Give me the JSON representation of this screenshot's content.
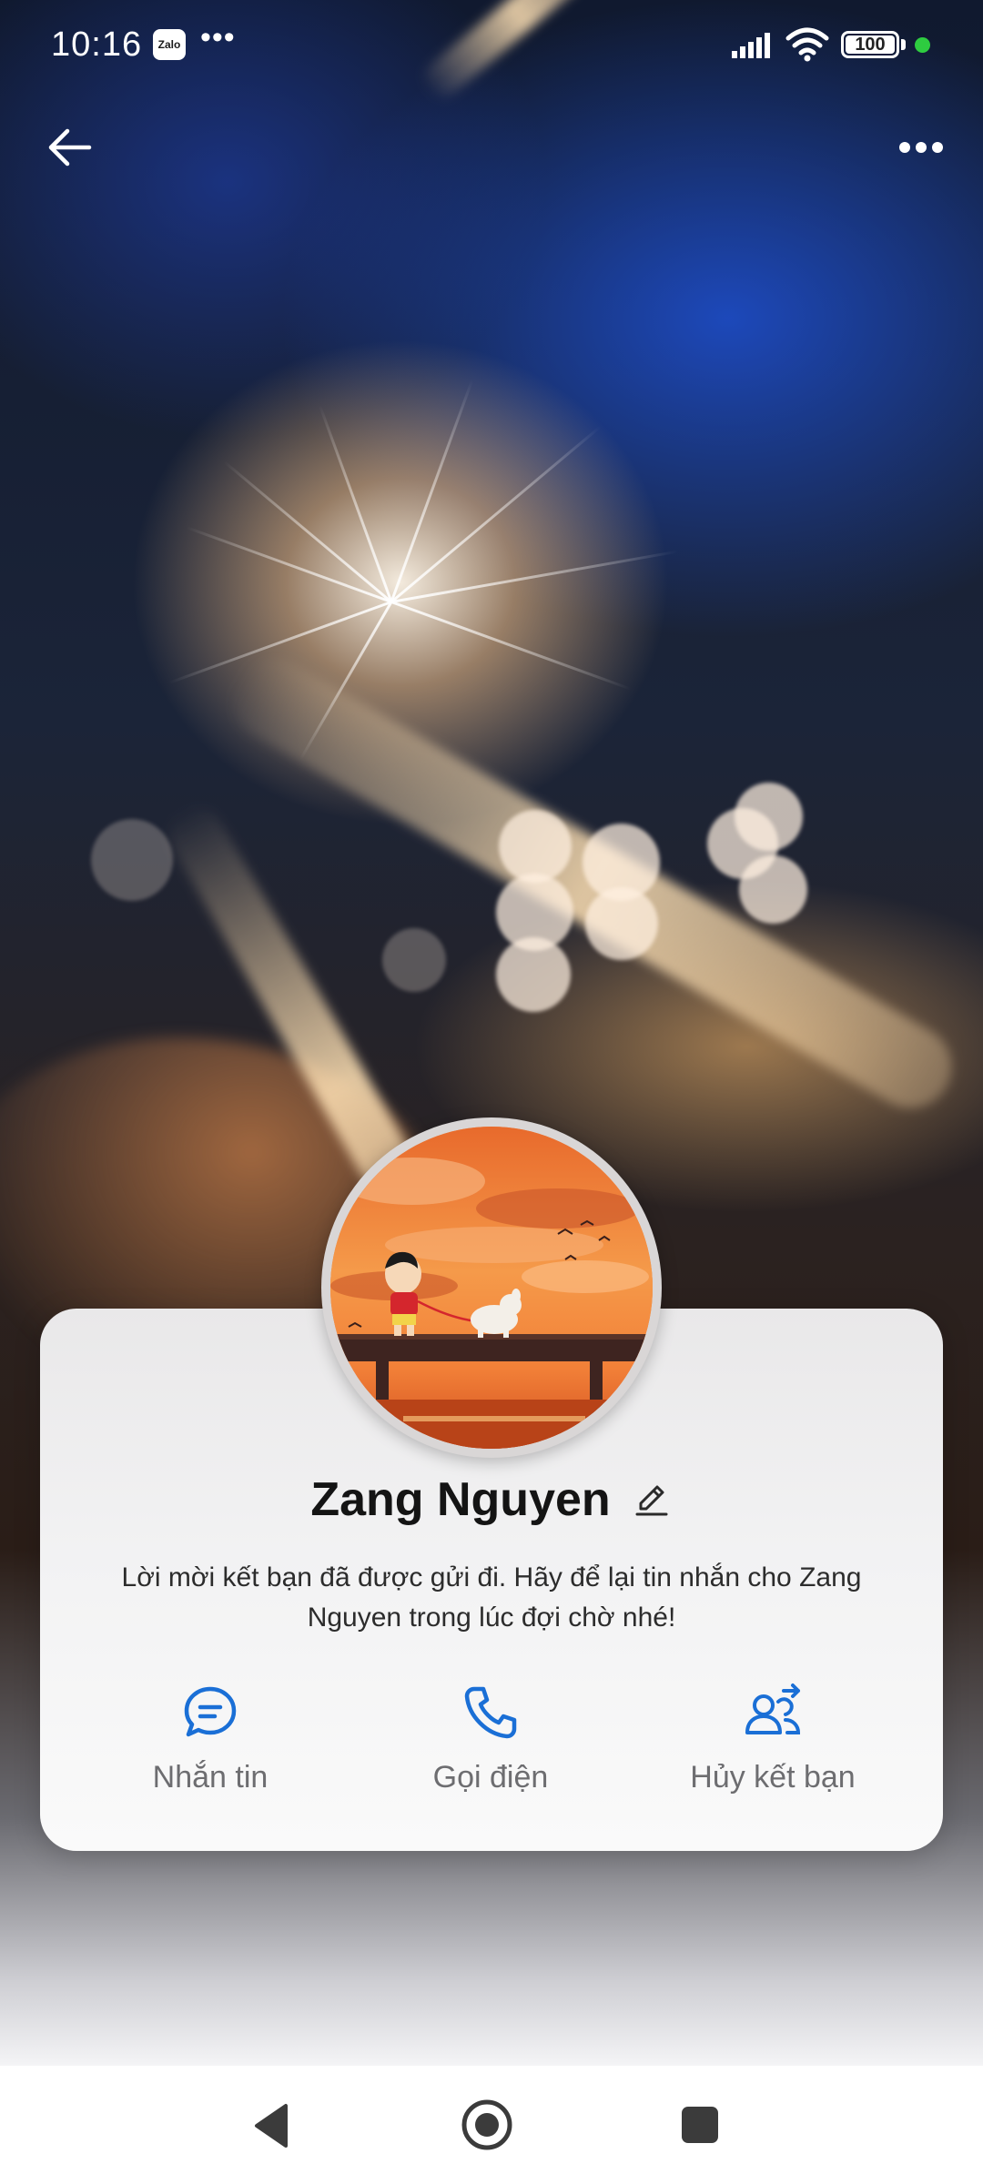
{
  "status_bar": {
    "time": "10:16",
    "app_badge": "Zalo",
    "more_dots": "•••",
    "battery_percent": 100,
    "battery_text": "100"
  },
  "header": {
    "back_icon": "arrow-left-icon",
    "more_icon": "more-horizontal-icon"
  },
  "profile": {
    "name": "Zang Nguyen",
    "edit_icon": "pencil-icon",
    "message": "Lời mời kết bạn đã được gửi đi. Hãy để lại tin nhắn cho Zang Nguyen trong lúc đợi chờ nhé!"
  },
  "actions": [
    {
      "label": "Nhắn tin",
      "icon": "chat-bubble-icon"
    },
    {
      "label": "Gọi điện",
      "icon": "phone-icon"
    },
    {
      "label": "Hủy kết bạn",
      "icon": "unfriend-icon"
    }
  ],
  "nav_bar": {
    "back_icon": "nav-back-icon",
    "home_icon": "nav-home-icon",
    "recents_icon": "nav-recents-icon"
  },
  "colors": {
    "accent": "#1a6fd6",
    "label_gray": "#6d6d70",
    "status_green": "#2ecc40"
  }
}
